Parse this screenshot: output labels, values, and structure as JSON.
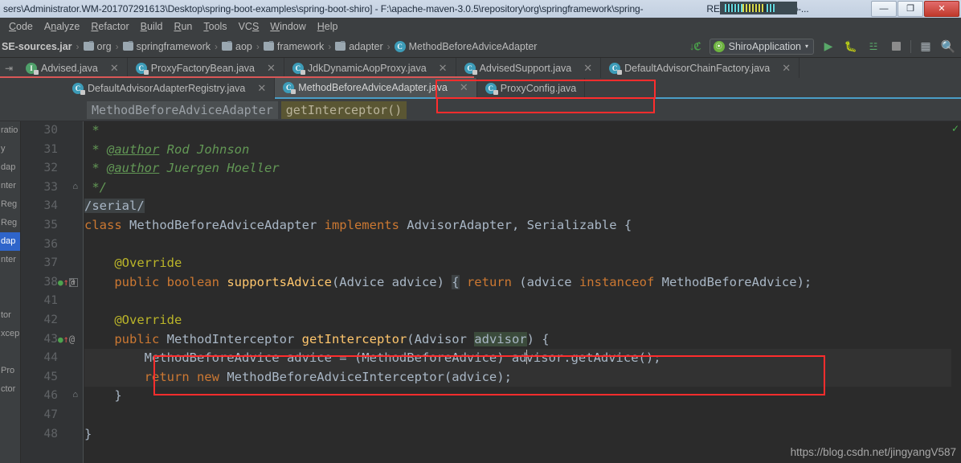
{
  "window": {
    "title": "sers\\Administrator.WM-201707291613\\Desktop\\spring-boot-examples\\spring-boot-shiro] - F:\\apache-maven-3.0.5\\repository\\org\\springframework\\spring-",
    "title_tail": "RELEASE\\spring-aop-...",
    "minimize_label": "—",
    "maximize_label": "❐",
    "close_label": "✕"
  },
  "menubar": {
    "items": [
      {
        "pre": "",
        "mn": "C",
        "post": "ode"
      },
      {
        "pre": "A",
        "mn": "n",
        "post": "alyze"
      },
      {
        "pre": "",
        "mn": "R",
        "post": "efactor"
      },
      {
        "pre": "",
        "mn": "B",
        "post": "uild"
      },
      {
        "pre": "",
        "mn": "R",
        "post": "un"
      },
      {
        "pre": "",
        "mn": "T",
        "post": "ools"
      },
      {
        "pre": "VC",
        "mn": "S",
        "post": ""
      },
      {
        "pre": "",
        "mn": "W",
        "post": "indow"
      },
      {
        "pre": "",
        "mn": "H",
        "post": "elp"
      }
    ]
  },
  "navbar": {
    "crumbs": [
      {
        "label": "SE-sources.jar",
        "icon": "jar-icon",
        "bold": true
      },
      {
        "label": "org",
        "icon": "folder-icon",
        "bold": false
      },
      {
        "label": "springframework",
        "icon": "folder-icon",
        "bold": false
      },
      {
        "label": "aop",
        "icon": "folder-icon",
        "bold": false
      },
      {
        "label": "framework",
        "icon": "folder-icon",
        "bold": false
      },
      {
        "label": "adapter",
        "icon": "folder-icon",
        "bold": false
      },
      {
        "label": "MethodBeforeAdviceAdapter",
        "icon": "class-icon",
        "bold": false
      }
    ],
    "separator": "›",
    "run_config": "ShiroApplication",
    "run_caret": "▾",
    "icons": {
      "sort": "01\n10\n01",
      "run": "▶",
      "debug": "ὁE",
      "coverage": "░",
      "stop": "",
      "layout": "▦",
      "search": "⌕"
    }
  },
  "tabs": {
    "row1": [
      {
        "label": "Advised.java",
        "kind": "interface",
        "glyph": "I",
        "active": false,
        "close": "✕"
      },
      {
        "label": "ProxyFactoryBean.java",
        "kind": "class",
        "glyph": "C",
        "active": false,
        "close": "✕"
      },
      {
        "label": "JdkDynamicAopProxy.java",
        "kind": "class",
        "glyph": "C",
        "active": false,
        "close": "✕"
      },
      {
        "label": "AdvisedSupport.java",
        "kind": "class",
        "glyph": "C",
        "active": false,
        "close": "✕"
      },
      {
        "label": "DefaultAdvisorChainFactory.java",
        "kind": "class",
        "glyph": "C",
        "active": false,
        "close": "✕"
      }
    ],
    "row2": [
      {
        "label": "DefaultAdvisorAdapterRegistry.java",
        "kind": "class",
        "glyph": "C",
        "active": false,
        "close": "✕"
      },
      {
        "label": "MethodBeforeAdviceAdapter.java",
        "kind": "class",
        "glyph": "C",
        "active": true,
        "close": "✕"
      },
      {
        "label": "ProxyConfig.java",
        "kind": "class",
        "glyph": "C",
        "active": false,
        "close": ""
      }
    ]
  },
  "structure_bar": {
    "class_chip": "MethodBeforeAdviceAdapter",
    "member_chip": "getInterceptor()"
  },
  "left_strip": {
    "rows": [
      {
        "text": "ratio",
        "selected": false
      },
      {
        "text": "y",
        "selected": false
      },
      {
        "text": "dap",
        "selected": false
      },
      {
        "text": "nter",
        "selected": false
      },
      {
        "text": "Reg",
        "selected": false
      },
      {
        "text": "Reg",
        "selected": false
      },
      {
        "text": "dap",
        "selected": true
      },
      {
        "text": "nter",
        "selected": false
      },
      {
        "text": "",
        "selected": false
      },
      {
        "text": "",
        "selected": false
      },
      {
        "text": "tor",
        "selected": false
      },
      {
        "text": "xcep",
        "selected": false
      },
      {
        "text": "",
        "selected": false
      },
      {
        "text": "Pro",
        "selected": false
      },
      {
        "text": "ctor",
        "selected": false
      }
    ]
  },
  "editor": {
    "lines": [
      {
        "num": "30",
        "indent": 0,
        "marks": "",
        "fold": "",
        "tokens": [
          {
            "t": " * ",
            "c": "c-cmt"
          }
        ]
      },
      {
        "num": "31",
        "indent": 0,
        "marks": "",
        "fold": "",
        "tokens": [
          {
            "t": " * ",
            "c": "c-cmt"
          },
          {
            "t": "@author",
            "c": "c-tag"
          },
          {
            "t": " Rod Johnson",
            "c": "c-cmt"
          }
        ]
      },
      {
        "num": "32",
        "indent": 0,
        "marks": "",
        "fold": "",
        "tokens": [
          {
            "t": " * ",
            "c": "c-cmt"
          },
          {
            "t": "@author",
            "c": "c-tag"
          },
          {
            "t": " Juergen Hoeller",
            "c": "c-cmt"
          }
        ]
      },
      {
        "num": "33",
        "indent": 0,
        "marks": "",
        "fold": "tri",
        "tokens": [
          {
            "t": " */",
            "c": "c-cmt"
          }
        ]
      },
      {
        "num": "34",
        "indent": 0,
        "marks": "",
        "fold": "",
        "tokens": [
          {
            "t": "/serial/",
            "c": "c-hl c-txt"
          }
        ]
      },
      {
        "num": "35",
        "indent": 0,
        "marks": "",
        "fold": "",
        "tokens": [
          {
            "t": "class",
            "c": "c-kw"
          },
          {
            "t": " MethodBeforeAdviceAdapter ",
            "c": "c-txt"
          },
          {
            "t": "implements",
            "c": "c-kw"
          },
          {
            "t": " AdvisorAdapter, Serializable {",
            "c": "c-txt"
          }
        ]
      },
      {
        "num": "36",
        "indent": 0,
        "marks": "",
        "fold": "",
        "tokens": []
      },
      {
        "num": "37",
        "indent": 0,
        "marks": "",
        "fold": "",
        "tokens": [
          {
            "t": "    @Override",
            "c": "c-ann"
          }
        ]
      },
      {
        "num": "38",
        "indent": 0,
        "marks": "impl",
        "fold": "box",
        "tokens": [
          {
            "t": "    ",
            "c": "c-txt"
          },
          {
            "t": "public boolean ",
            "c": "c-kw"
          },
          {
            "t": "supportsAdvice",
            "c": "c-meth"
          },
          {
            "t": "(Advice advice) ",
            "c": "c-txt"
          },
          {
            "t": "{",
            "c": "c-hl c-txt"
          },
          {
            "t": " ",
            "c": "c-txt"
          },
          {
            "t": "return",
            "c": "c-kw"
          },
          {
            "t": " (advice ",
            "c": "c-txt"
          },
          {
            "t": "instanceof",
            "c": "c-kw"
          },
          {
            "t": " MethodBeforeAdvice);",
            "c": "c-txt"
          }
        ]
      },
      {
        "num": "41",
        "indent": 0,
        "marks": "",
        "fold": "",
        "tokens": []
      },
      {
        "num": "42",
        "indent": 0,
        "marks": "",
        "fold": "",
        "tokens": [
          {
            "t": "    @Override",
            "c": "c-ann"
          }
        ]
      },
      {
        "num": "43",
        "indent": 0,
        "marks": "impl",
        "fold": "",
        "tokens": [
          {
            "t": "    ",
            "c": "c-txt"
          },
          {
            "t": "public ",
            "c": "c-kw"
          },
          {
            "t": "MethodInterceptor ",
            "c": "c-txt"
          },
          {
            "t": "getInterceptor",
            "c": "c-meth"
          },
          {
            "t": "(Advisor ",
            "c": "c-txt"
          },
          {
            "t": "advisor",
            "c": "c-param c-txt"
          },
          {
            "t": ") {",
            "c": "c-txt"
          }
        ]
      },
      {
        "num": "44",
        "indent": 0,
        "marks": "",
        "fold": "",
        "highlighted": true,
        "tokens": [
          {
            "t": "        MethodBeforeAdvice advice = (MethodBeforeAdvice) ad",
            "c": "c-txt"
          },
          {
            "t": "|CURSOR|",
            "c": "cursor"
          },
          {
            "t": "visor.getAdvice();",
            "c": "c-txt"
          }
        ]
      },
      {
        "num": "45",
        "indent": 0,
        "marks": "",
        "fold": "",
        "highlighted": true,
        "tokens": [
          {
            "t": "        ",
            "c": "c-txt"
          },
          {
            "t": "return new ",
            "c": "c-kw"
          },
          {
            "t": "MethodBeforeAdviceInterceptor(advice);",
            "c": "c-txt"
          }
        ]
      },
      {
        "num": "46",
        "indent": 0,
        "marks": "",
        "fold": "tri",
        "tokens": [
          {
            "t": "    }",
            "c": "c-txt"
          }
        ]
      },
      {
        "num": "47",
        "indent": 0,
        "marks": "",
        "fold": "",
        "tokens": []
      },
      {
        "num": "48",
        "indent": 0,
        "marks": "",
        "fold": "",
        "tokens": [
          {
            "t": "}",
            "c": "c-txt"
          }
        ]
      }
    ]
  },
  "annotations": {
    "tab_box_label": "active-tab-highlight",
    "code_box_label": "getInterceptor-body-highlight",
    "color": "#ff2d2d"
  },
  "watermark": "https://blog.csdn.net/jingyangV587"
}
